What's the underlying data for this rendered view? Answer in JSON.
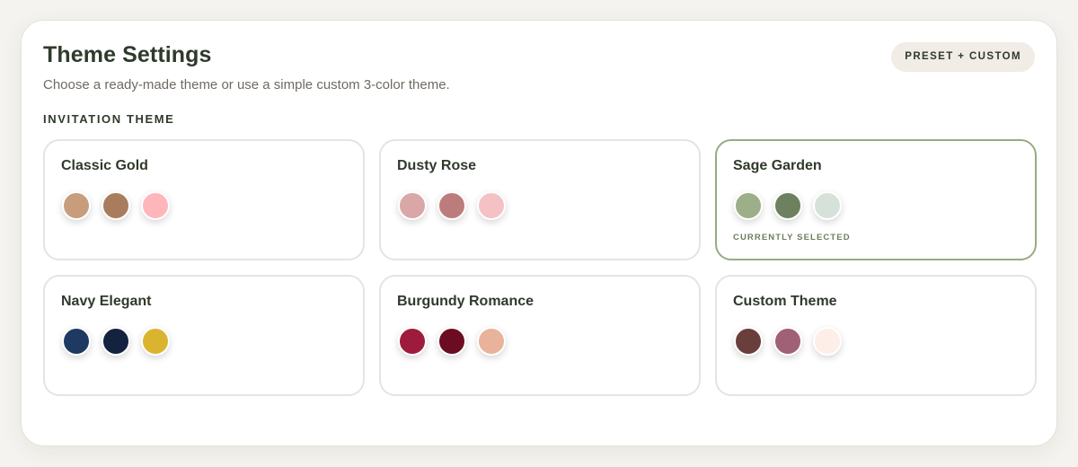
{
  "header": {
    "title": "Theme Settings",
    "subtitle": "Choose a ready-made theme or use a simple custom 3-color theme.",
    "mode_badge": "PRESET + CUSTOM"
  },
  "section": {
    "label": "INVITATION THEME"
  },
  "themes": [
    {
      "name": "Classic Gold",
      "selected": false,
      "colors": [
        "#c89d7c",
        "#a87d5e",
        "#ffb6ba"
      ]
    },
    {
      "name": "Dusty Rose",
      "selected": false,
      "colors": [
        "#d9a7a7",
        "#bd7c7c",
        "#f4c2c5"
      ]
    },
    {
      "name": "Sage Garden",
      "selected": true,
      "selected_label": "CURRENTLY SELECTED",
      "colors": [
        "#9caf88",
        "#6d8060",
        "#d6e2d9"
      ]
    },
    {
      "name": "Navy Elegant",
      "selected": false,
      "colors": [
        "#1e3a63",
        "#13233f",
        "#dbb42f"
      ]
    },
    {
      "name": "Burgundy Romance",
      "selected": false,
      "colors": [
        "#9f1b3e",
        "#6b0c22",
        "#e8b39a"
      ]
    },
    {
      "name": "Custom Theme",
      "selected": false,
      "colors": [
        "#6a3e3b",
        "#a06075",
        "#fdeee8"
      ]
    }
  ],
  "colors": {
    "selected_border": "#97ab86",
    "text_dark": "#2f3a2b",
    "badge_bg": "#f1ece5"
  }
}
